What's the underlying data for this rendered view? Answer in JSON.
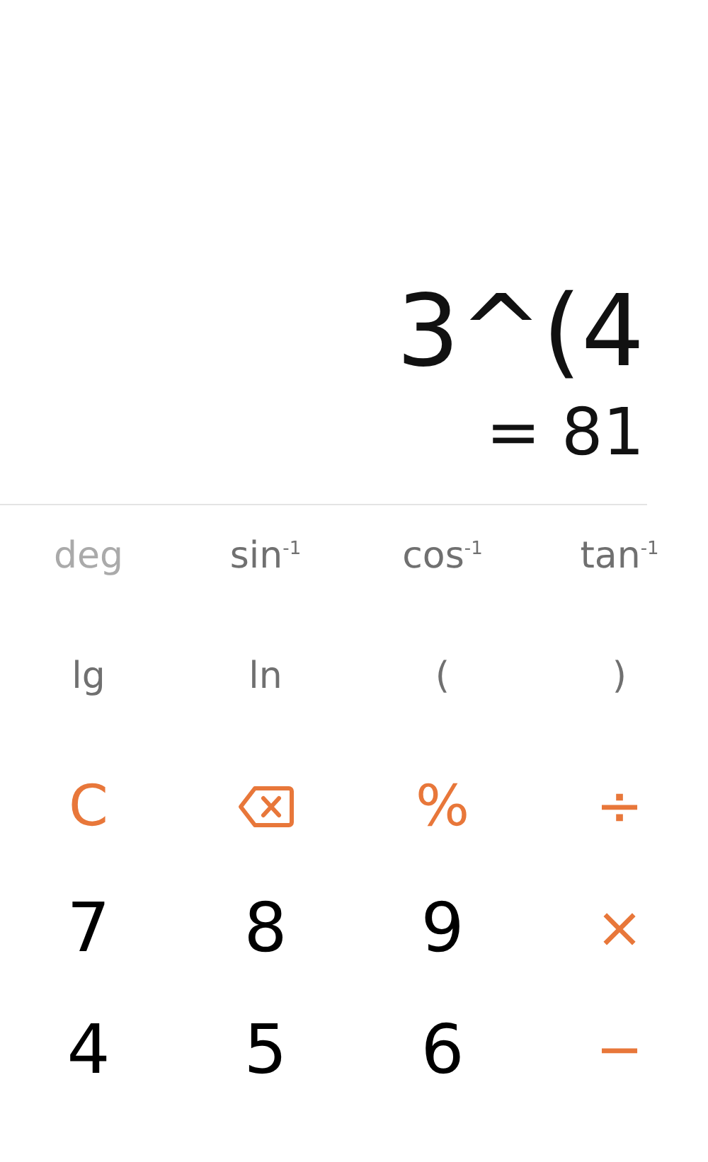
{
  "display": {
    "expression": "3^(4",
    "result": "= 81"
  },
  "function_rows": [
    [
      {
        "label": "deg",
        "kind": "mode"
      },
      {
        "label": "sin$^{-1}$",
        "kind": "function"
      },
      {
        "label": "cos$^{-1}$",
        "kind": "function"
      },
      {
        "label": "tan$^{-1}$",
        "kind": "function"
      }
    ],
    [
      {
        "label": "lg",
        "kind": "function"
      },
      {
        "label": "ln",
        "kind": "function"
      },
      {
        "label": "(",
        "kind": "function"
      },
      {
        "label": ")",
        "kind": "function"
      }
    ]
  ],
  "keypad_rows": [
    [
      {
        "label": "C",
        "kind": "operator"
      },
      {
        "kind": "backspace"
      },
      {
        "label": "%",
        "kind": "operator"
      },
      {
        "label": "÷",
        "kind": "operator"
      }
    ],
    [
      {
        "label": "7",
        "kind": "digit"
      },
      {
        "label": "8",
        "kind": "digit"
      },
      {
        "label": "9",
        "kind": "digit"
      },
      {
        "label": "×",
        "kind": "operator"
      }
    ],
    [
      {
        "label": "4",
        "kind": "digit"
      },
      {
        "label": "5",
        "kind": "digit"
      },
      {
        "label": "6",
        "kind": "digit"
      },
      {
        "label": "−",
        "kind": "operator"
      }
    ]
  ]
}
